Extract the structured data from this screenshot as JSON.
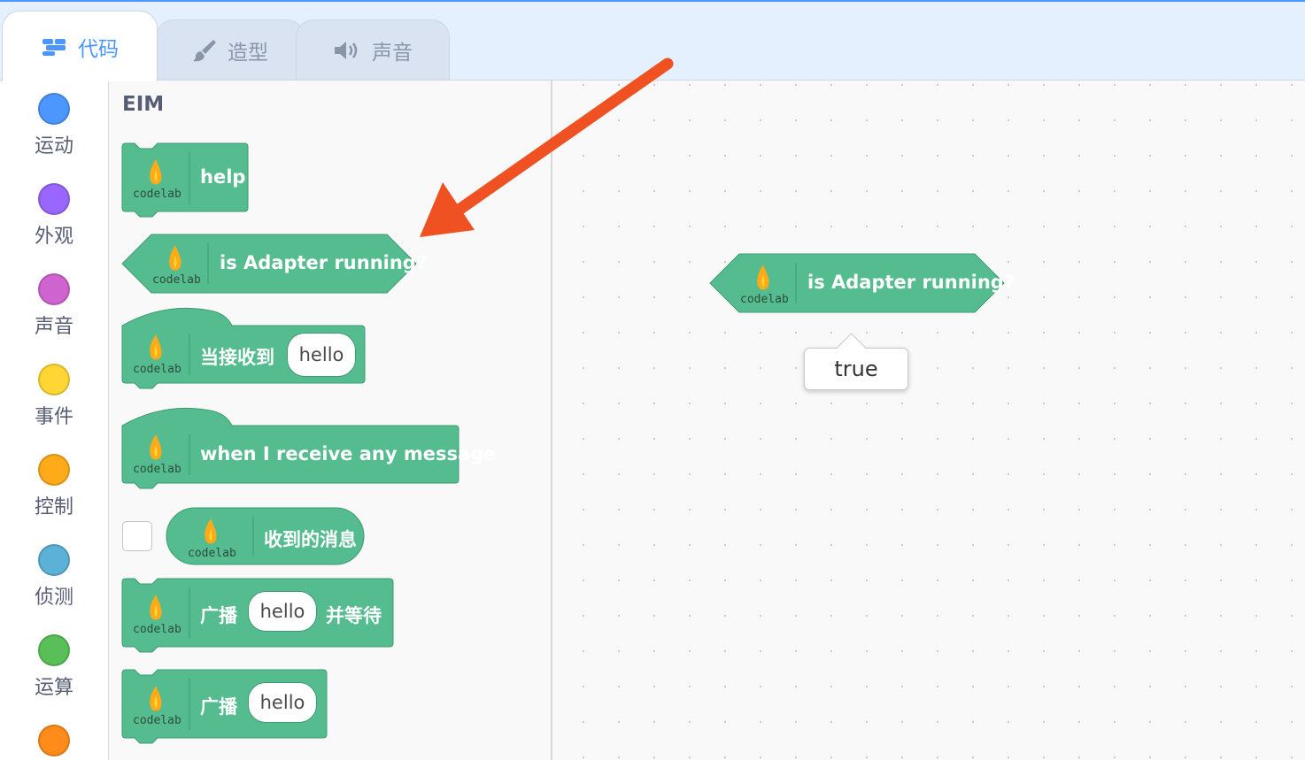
{
  "tabs": [
    {
      "label": "代码",
      "icon": "code-icon"
    },
    {
      "label": "造型",
      "icon": "brush-icon"
    },
    {
      "label": "声音",
      "icon": "speaker-icon"
    }
  ],
  "categories": [
    {
      "label": "运动",
      "color": "#4c97ff"
    },
    {
      "label": "外观",
      "color": "#9966ff"
    },
    {
      "label": "声音",
      "color": "#cf63cf"
    },
    {
      "label": "事件",
      "color": "#ffd633"
    },
    {
      "label": "控制",
      "color": "#ffab19"
    },
    {
      "label": "侦测",
      "color": "#5cb1d6"
    },
    {
      "label": "运算",
      "color": "#59c059"
    },
    {
      "label": "",
      "color": "#ff8c1a"
    }
  ],
  "palette": {
    "title": "EIM",
    "icon_text": "codelab",
    "blocks": {
      "help": "help",
      "adapter": "is Adapter running?",
      "when_receive": "当接收到",
      "when_receive_value": "hello",
      "any_message": "when I receive any message",
      "received_msg": "收到的消息",
      "broadcast_wait_pre": "广播",
      "broadcast_wait_value": "hello",
      "broadcast_wait_post": "并等待",
      "broadcast": "广播",
      "broadcast_value": "hello"
    }
  },
  "workspace": {
    "block_label": "is Adapter running?",
    "tooltip": "true"
  },
  "colors": {
    "block": "#54bc8f",
    "block_border": "#3f9a72",
    "arrow": "#f05123",
    "accent": "#4c97ff"
  }
}
